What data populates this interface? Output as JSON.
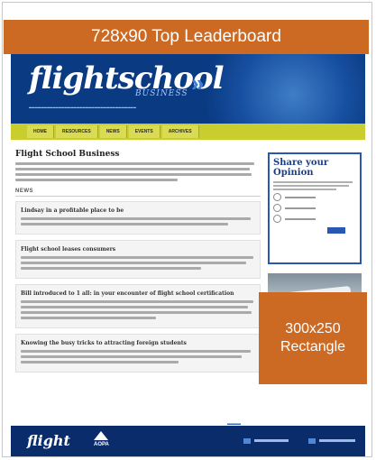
{
  "ads": {
    "leaderboard": "728x90 Top Leaderboard",
    "rectangle_line1": "300x250",
    "rectangle_line2": "Rectangle"
  },
  "header": {
    "logo": "flightschool",
    "logo_sub": "BUSINESS",
    "chevron": "»"
  },
  "nav": {
    "items": [
      "HOME",
      "RESOURCES",
      "NEWS",
      "EVENTS",
      "ARCHIVES"
    ]
  },
  "main": {
    "title": "Flight School Business",
    "news_heading": "NEWS",
    "articles": [
      {
        "title": "Lindsay in a profitable place to be"
      },
      {
        "title": "Flight school leases consumers"
      },
      {
        "title": "Bill introduced to 1 all: in your encounter of flight school certification"
      },
      {
        "title": "Knowing the busy tricks to attracting foreign students"
      }
    ]
  },
  "sidebar": {
    "opinion_title": "Share your Opinion"
  },
  "footer": {
    "logo": "flight",
    "aopa": "AOPA"
  },
  "colors": {
    "ad_orange": "#cc6a24",
    "header_blue": "#0a3a82",
    "nav_yellow": "#c9cd2e"
  }
}
